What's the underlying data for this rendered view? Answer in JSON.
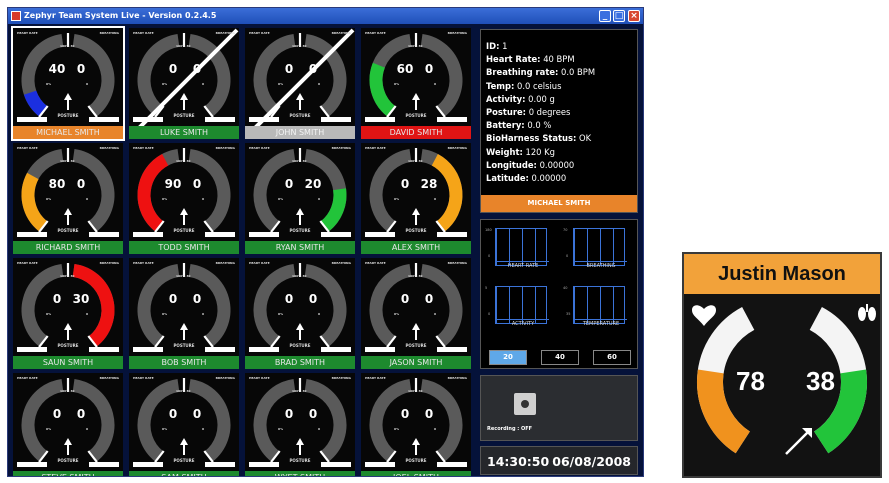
{
  "window": {
    "title": "Zephyr Team System Live - Version 0.2.4.5",
    "minimize": "_",
    "maximize": "□",
    "close": "×"
  },
  "gauge_labels": {
    "heart_rate": "HEART RATE",
    "breathing": "BREATHING",
    "posture": "POSTURE",
    "scale_top": "100% 30",
    "scale_low": "0%",
    "scale_zero": "0"
  },
  "tiles": [
    {
      "name": "MICHAEL SMITH",
      "hr": "40",
      "br": "0",
      "bar": "#e8842a",
      "hr_fill": 0.25,
      "hr_color": "#1b2fe0",
      "br_fill": 0,
      "br_color": "#22c43a",
      "selected": true,
      "crossed": false
    },
    {
      "name": "LUKE SMITH",
      "hr": "0",
      "br": "0",
      "bar": "#1d8a2e",
      "hr_fill": 0,
      "hr_color": "#ff0000",
      "br_fill": 0,
      "br_color": "#22c43a",
      "selected": false,
      "crossed": true
    },
    {
      "name": "JOHN SMITH",
      "hr": "0",
      "br": "0",
      "bar": "#b9b9b9",
      "hr_fill": 0,
      "hr_color": "#ff0000",
      "br_fill": 0,
      "br_color": "#22c43a",
      "selected": false,
      "crossed": true
    },
    {
      "name": "DAVID SMITH",
      "hr": "60",
      "br": "0",
      "bar": "#e01414",
      "hr_fill": 0.55,
      "hr_color": "#22c43a",
      "br_fill": 0,
      "br_color": "#22c43a",
      "selected": false,
      "crossed": false
    },
    {
      "name": "RICHARD SMITH",
      "hr": "80",
      "br": "0",
      "bar": "#1d8a2e",
      "hr_fill": 0.6,
      "hr_color": "#f5a418",
      "br_fill": 0,
      "br_color": "#22c43a",
      "selected": false,
      "crossed": false
    },
    {
      "name": "TODD SMITH",
      "hr": "90",
      "br": "0",
      "bar": "#1d8a2e",
      "hr_fill": 0.85,
      "hr_color": "#ee1111",
      "br_fill": 0,
      "br_color": "#22c43a",
      "selected": false,
      "crossed": false
    },
    {
      "name": "RYAN SMITH",
      "hr": "0",
      "br": "20",
      "bar": "#1d8a2e",
      "hr_fill": 0,
      "hr_color": "#ff0000",
      "br_fill": 0.45,
      "br_color": "#22c43a",
      "selected": false,
      "crossed": false
    },
    {
      "name": "ALEX SMITH",
      "hr": "0",
      "br": "28",
      "bar": "#1d8a2e",
      "hr_fill": 0,
      "hr_color": "#ff0000",
      "br_fill": 0.85,
      "br_color": "#f5a418",
      "selected": false,
      "crossed": false
    },
    {
      "name": "SAUN SMITH",
      "hr": "0",
      "br": "30",
      "bar": "#1d8a2e",
      "hr_fill": 0,
      "hr_color": "#ff0000",
      "br_fill": 1.0,
      "br_color": "#ee1111",
      "selected": false,
      "crossed": false
    },
    {
      "name": "BOB SMITH",
      "hr": "0",
      "br": "0",
      "bar": "#1d8a2e",
      "hr_fill": 0,
      "hr_color": "#ff0000",
      "br_fill": 0,
      "br_color": "#22c43a",
      "selected": false,
      "crossed": false
    },
    {
      "name": "BRAD SMITH",
      "hr": "0",
      "br": "0",
      "bar": "#1d8a2e",
      "hr_fill": 0,
      "hr_color": "#ff0000",
      "br_fill": 0,
      "br_color": "#22c43a",
      "selected": false,
      "crossed": false
    },
    {
      "name": "JASON SMITH",
      "hr": "0",
      "br": "0",
      "bar": "#1d8a2e",
      "hr_fill": 0,
      "hr_color": "#ff0000",
      "br_fill": 0,
      "br_color": "#22c43a",
      "selected": false,
      "crossed": false
    },
    {
      "name": "STEVE SMITH",
      "hr": "0",
      "br": "0",
      "bar": "#1d8a2e",
      "hr_fill": 0,
      "hr_color": "#ff0000",
      "br_fill": 0,
      "br_color": "#22c43a",
      "selected": false,
      "crossed": false
    },
    {
      "name": "SAM SMITH",
      "hr": "0",
      "br": "0",
      "bar": "#1d8a2e",
      "hr_fill": 0,
      "hr_color": "#ff0000",
      "br_fill": 0,
      "br_color": "#22c43a",
      "selected": false,
      "crossed": false
    },
    {
      "name": "WYET SMITH",
      "hr": "0",
      "br": "0",
      "bar": "#1d8a2e",
      "hr_fill": 0,
      "hr_color": "#ff0000",
      "br_fill": 0,
      "br_color": "#22c43a",
      "selected": false,
      "crossed": false
    },
    {
      "name": "JOEL SMITH",
      "hr": "0",
      "br": "0",
      "bar": "#1d8a2e",
      "hr_fill": 0,
      "hr_color": "#ff0000",
      "br_fill": 0,
      "br_color": "#22c43a",
      "selected": false,
      "crossed": false
    }
  ],
  "info": {
    "rows": [
      {
        "label": "ID:",
        "value": "1"
      },
      {
        "label": "Heart Rate:",
        "value": "40 BPM"
      },
      {
        "label": "Breathing rate:",
        "value": "0.0 BPM"
      },
      {
        "label": "Temp:",
        "value": "0.0 celsius"
      },
      {
        "label": "Activity:",
        "value": "0.00 g"
      },
      {
        "label": "Posture:",
        "value": "0 degrees"
      },
      {
        "label": "Battery:",
        "value": "0.0 %"
      },
      {
        "label": "BioHarness Status:",
        "value": "OK"
      },
      {
        "label": "Weight:",
        "value": "120 Kg"
      },
      {
        "label": "Longitude:",
        "value": "0.00000"
      },
      {
        "label": "Latitude:",
        "value": "0.00000"
      }
    ],
    "footer_name": "MICHAEL SMITH"
  },
  "trends": {
    "charts": [
      {
        "caption": "HEART RATE",
        "ymax": "180",
        "ymin": "0"
      },
      {
        "caption": "BREATHING",
        "ymax": "70",
        "ymin": "0"
      },
      {
        "caption": "ACTIVITY",
        "ymax": "5",
        "ymin": "0"
      },
      {
        "caption": "TEMPERATURE",
        "ymax": "40",
        "ymin": "35"
      }
    ],
    "time_buttons": [
      "20",
      "40",
      "60"
    ],
    "time_selected": "20"
  },
  "recording": {
    "label": "Recording : OFF"
  },
  "clock": {
    "time": "14:30:50",
    "date": "06/08/2008"
  },
  "big_gauge": {
    "name": "Justin Mason",
    "hr": "78",
    "br": "38",
    "header_color": "#f2a23a",
    "hr_fill": 0.55,
    "hr_color": "#f0921e",
    "br_fill": 0.55,
    "br_color": "#22c43a"
  }
}
